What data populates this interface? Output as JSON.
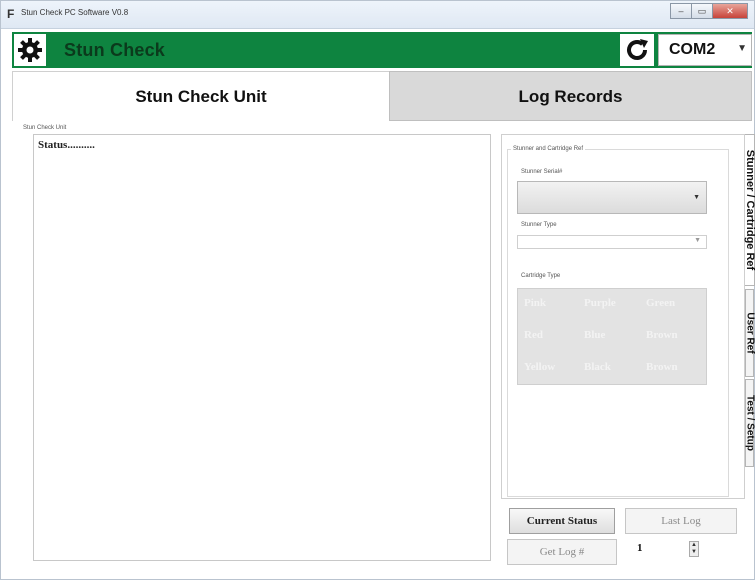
{
  "window": {
    "title": "Stun Check PC Software V0.8",
    "controls": [
      "–",
      "▭",
      "✕"
    ]
  },
  "header": {
    "app_name": "Stun Check",
    "com_port": "COM2",
    "accent_color": "#0e8440",
    "settings_icon": "gear-icon",
    "refresh_icon": "refresh-icon"
  },
  "tabs": [
    {
      "label": "Stun Check Unit",
      "active": true
    },
    {
      "label": "Log Records",
      "active": false
    }
  ],
  "unit_panel": {
    "group_label": "Stun Check Unit",
    "status_text": "Status.........."
  },
  "stunner_ref": {
    "group_label": "Stunner and Cartridge Ref",
    "serial_label": "Stunner Serial#",
    "serial_value": "",
    "type_label": "Stunner Type",
    "type_value": "",
    "cartridge_label": "Cartridge Type",
    "cartridge_types": [
      "Pink",
      "Purple",
      "Green",
      "Red",
      "Blue",
      "Brown",
      "Yellow",
      "Black",
      "Brown"
    ]
  },
  "side_tabs": [
    {
      "label": "Stunner / Cartridge Ref",
      "active": true
    },
    {
      "label": "User Ref",
      "active": false
    },
    {
      "label": "Test / Setup",
      "active": false
    }
  ],
  "actions": {
    "current_status": "Current Status",
    "last_log": "Last Log",
    "get_log": "Get Log #",
    "log_number": "1"
  }
}
